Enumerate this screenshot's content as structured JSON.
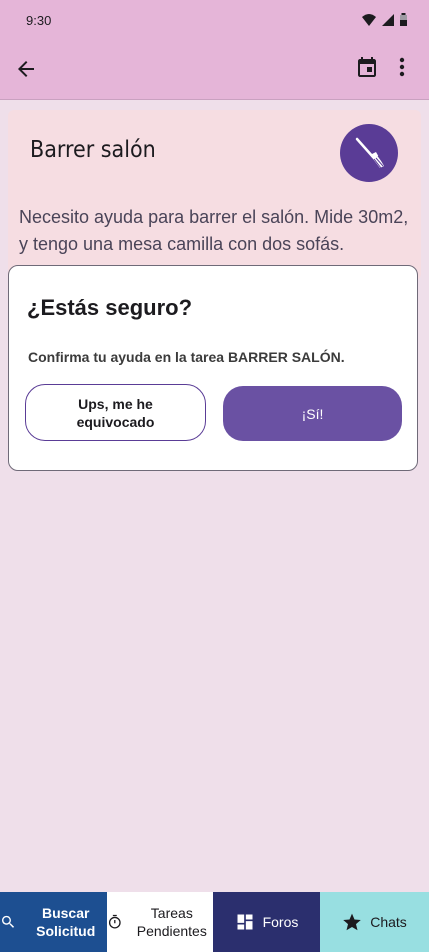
{
  "status": {
    "time": "9:30"
  },
  "task": {
    "title": "Barrer salón",
    "description": "Necesito ayuda para barrer el salón. Mide 30m2, y tengo una mesa camilla con dos sofás."
  },
  "dialog": {
    "title": "¿Estás seguro?",
    "message": "Confirma tu ayuda en la tarea BARRER SALÓN.",
    "cancel_label": "Ups, me he equivocado",
    "confirm_label": "¡Sí!"
  },
  "nav": {
    "items": [
      {
        "label": "Buscar Solicitud",
        "icon": "search-icon"
      },
      {
        "label": "Tareas Pendientes",
        "icon": "timer-icon"
      },
      {
        "label": "Foros",
        "icon": "dashboard-icon"
      },
      {
        "label": "Chats",
        "icon": "star-icon"
      }
    ]
  },
  "colors": {
    "appbar": "#e5b5d8",
    "background": "#efdfea",
    "primary": "#6a51a3",
    "nav_search": "#1d4f91",
    "nav_forums": "#2b2f6e",
    "nav_chats": "#98dfe1"
  }
}
